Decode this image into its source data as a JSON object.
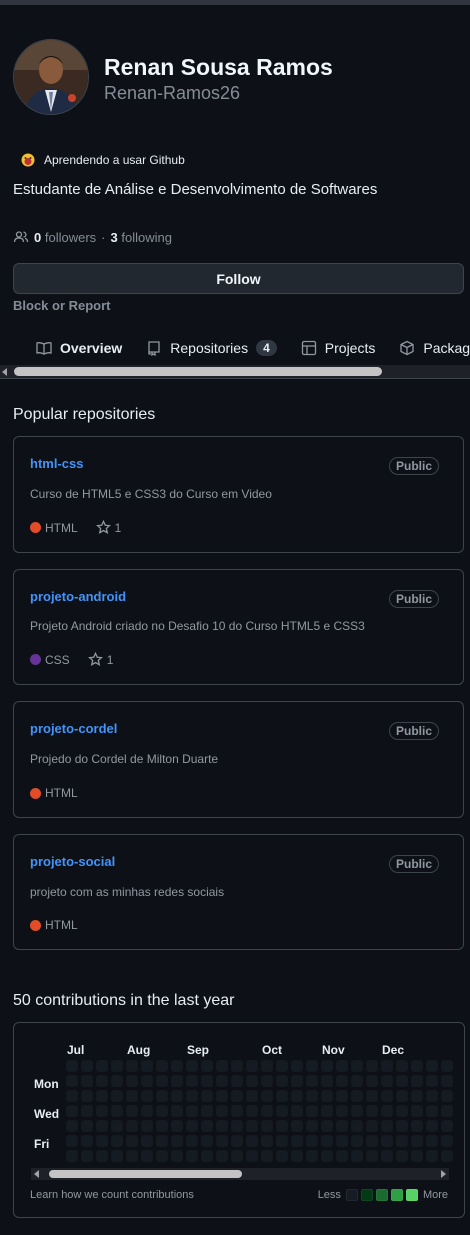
{
  "profile": {
    "name": "Renan Sousa Ramos",
    "login": "Renan-Ramos26",
    "status": "Aprendendo a usar Github",
    "bio": "Estudante de Análise e Desenvolvimento de Softwares",
    "followers_count": "0",
    "followers_label": "followers",
    "separator": "·",
    "following_count": "3",
    "following_label": "following",
    "follow_button": "Follow",
    "block_report": "Block or Report"
  },
  "tabs": [
    {
      "label": "Overview",
      "icon": "book-icon",
      "active": true
    },
    {
      "label": "Repositories",
      "icon": "repo-icon",
      "counter": "4"
    },
    {
      "label": "Projects",
      "icon": "table-icon"
    },
    {
      "label": "Packages",
      "icon": "package-icon"
    }
  ],
  "popular": {
    "title": "Popular repositories",
    "repos": [
      {
        "name": "html-css",
        "visibility": "Public",
        "description": "Curso de HTML5 e CSS3 do Curso em Video",
        "language": "HTML",
        "language_color": "#e34c26",
        "stars": "1"
      },
      {
        "name": "projeto-android",
        "visibility": "Public",
        "description": "Projeto Android criado no Desafio 10 do Curso HTML5 e CSS3",
        "language": "CSS",
        "language_color": "#663399",
        "stars": "1"
      },
      {
        "name": "projeto-cordel",
        "visibility": "Public",
        "description": "Projedo do Cordel de Milton Duarte",
        "language": "HTML",
        "language_color": "#e34c26"
      },
      {
        "name": "projeto-social",
        "visibility": "Public",
        "description": "projeto com as minhas redes sociais",
        "language": "HTML",
        "language_color": "#e34c26"
      }
    ]
  },
  "contributions": {
    "title": "50 contributions in the last year",
    "months": [
      "Jul",
      "Aug",
      "Sep",
      "Oct",
      "Nov",
      "Dec"
    ],
    "days": [
      "Mon",
      "Wed",
      "Fri"
    ],
    "learn_link": "Learn how we count contributions",
    "legend_less": "Less",
    "legend_more": "More",
    "legend_colors": [
      "#151b23",
      "#033a16",
      "#196c2e",
      "#2ea043",
      "#56d364"
    ]
  }
}
